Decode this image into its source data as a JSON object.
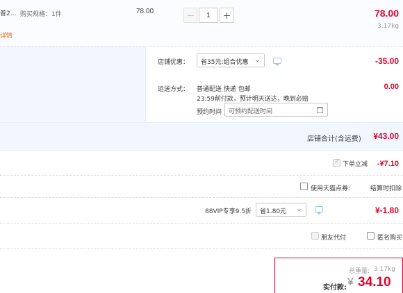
{
  "item": {
    "name_fragment": "普2...",
    "spec": "购买规格：1件",
    "detail_link": "详情",
    "unit_price": "78.00",
    "quantity": "1",
    "minus_icon": "minus-icon",
    "plus_icon": "plus-icon",
    "subtotal": "78.00",
    "weight": "3.17kg"
  },
  "shop_discount": {
    "label": "店铺优惠：",
    "selected": "省35元:组合优惠",
    "icon": "message-icon",
    "amount": "-35.00"
  },
  "shipping": {
    "label": "运送方式：",
    "method": "普通配送 快递 包邮",
    "note": "23:59前付款，预计明天送达，晚到必赔",
    "appointment_label": "预约时间",
    "appointment_placeholder": "可预约配送时间",
    "calendar_icon": "calendar-icon",
    "amount": "0.00"
  },
  "shop_total": {
    "label": "店铺合计(含运费)",
    "amount": "¥43.00"
  },
  "order_discount": {
    "label": "下单立减",
    "checked": true,
    "amount": "-¥7.10"
  },
  "tmall_points": {
    "label": "使用天猫点券:",
    "note": "结算时扣除"
  },
  "vip": {
    "label": "88VIP专享9.5折",
    "selected": "省1.80元",
    "icon": "message-icon",
    "amount": "¥-1.80"
  },
  "options": {
    "friend_pay": "朋友代付",
    "anonymous": "匿名购买"
  },
  "summary": {
    "weight_label": "总重量:",
    "weight_value": "3.17kg",
    "pay_label": "实付款:",
    "currency": "¥",
    "pay_amount": "34.10"
  },
  "colors": {
    "accent_red": "#e4002b",
    "shop_bg": "#f2f7ff",
    "summary_border": "#e4002b"
  }
}
